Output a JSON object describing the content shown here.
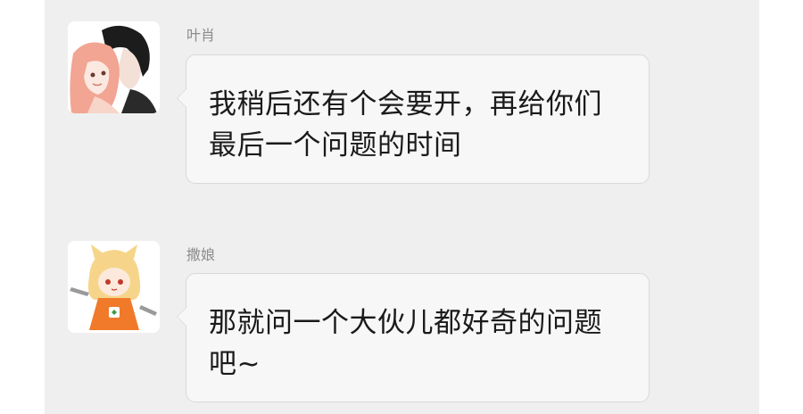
{
  "messages": [
    {
      "sender": "叶肖",
      "text": "我稍后还有个会要开，再给你们最后一个问题的时间",
      "avatar_icon": "couple-illustration-avatar"
    },
    {
      "sender": "撒娘",
      "text": "那就问一个大伙儿都好奇的问题吧~",
      "avatar_icon": "cat-girl-chibi-avatar"
    }
  ],
  "colors": {
    "background": "#efefef",
    "bubble": "#f7f7f7",
    "bubble_border": "#d9d9d9",
    "sender_name": "#8c8c8c",
    "text": "#1a1a1a"
  }
}
